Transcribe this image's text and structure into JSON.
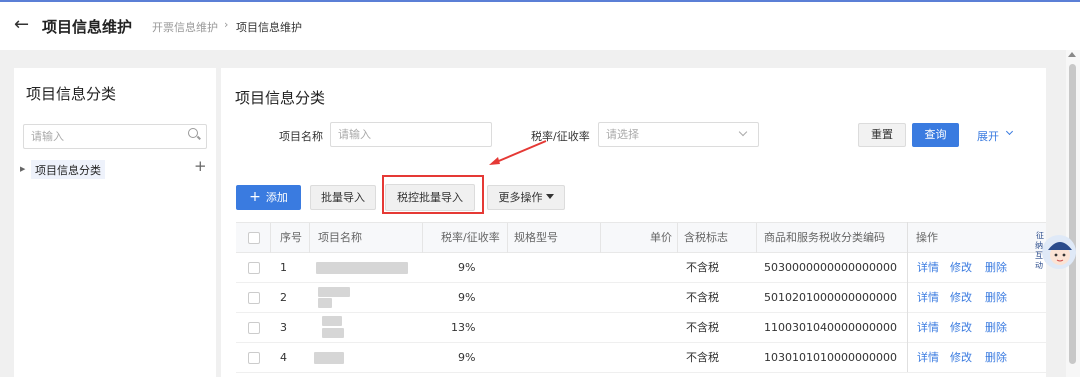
{
  "header": {
    "back_icon": "left-arrow-icon",
    "title": "项目信息维护",
    "breadcrumb": [
      "开票信息维护",
      "项目信息维护"
    ]
  },
  "left": {
    "title": "项目信息分类",
    "search_placeholder": "请输入",
    "tree": [
      {
        "label": "项目信息分类"
      }
    ]
  },
  "main": {
    "title": "项目信息分类",
    "filters": {
      "name_label": "项目名称",
      "name_placeholder": "请输入",
      "rate_label": "税率/征收率",
      "rate_placeholder": "请选择",
      "reset": "重置",
      "query": "查询",
      "expand": "展开"
    },
    "toolbar": {
      "add": "添加",
      "batch_import": "批量导入",
      "tax_batch_import": "税控批量导入",
      "more": "更多操作"
    },
    "table": {
      "columns": [
        "序号",
        "项目名称",
        "税率/征收率",
        "规格型号",
        "单价",
        "含税标志",
        "商品和服务税收分类编码",
        "操作"
      ],
      "rows": [
        {
          "no": "1",
          "rate": "9%",
          "spec": "",
          "price": "",
          "tax_flag": "不含税",
          "code": "5030000000000000000"
        },
        {
          "no": "2",
          "rate": "9%",
          "spec": "",
          "price": "",
          "tax_flag": "不含税",
          "code": "5010201000000000000"
        },
        {
          "no": "3",
          "rate": "13%",
          "spec": "",
          "price": "",
          "tax_flag": "不含税",
          "code": "1100301040000000000"
        },
        {
          "no": "4",
          "rate": "9%",
          "spec": "",
          "price": "",
          "tax_flag": "不含税",
          "code": "1030101010000000000"
        }
      ],
      "actions": [
        "详情",
        "修改",
        "删除"
      ]
    }
  },
  "mascot": {
    "lines": [
      "征",
      "纳",
      "互",
      "动"
    ]
  },
  "colors": {
    "primary": "#3a7be0",
    "highlight": "#e53935"
  }
}
